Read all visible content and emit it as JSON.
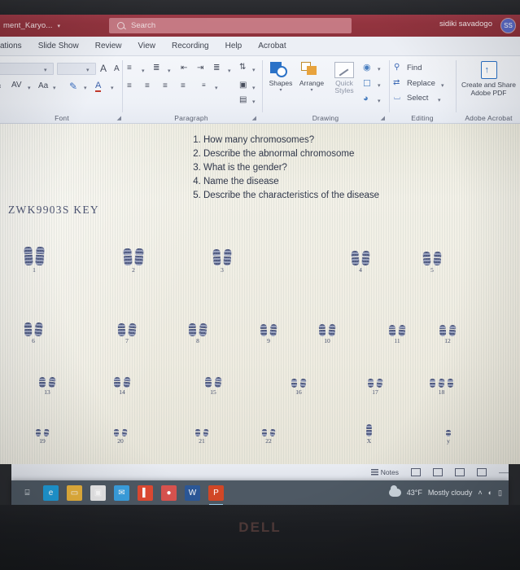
{
  "window": {
    "document_name": "ment_Karyo...",
    "caret": "▾",
    "account_name": "sidiki savadogo",
    "account_initials": "SS",
    "title_bar_color": "#93343f"
  },
  "search": {
    "placeholder": "Search",
    "icon": "search-icon"
  },
  "ribbon": {
    "tabs": [
      "ations",
      "Slide Show",
      "Review",
      "View",
      "Recording",
      "Help",
      "Acrobat"
    ],
    "groups": [
      {
        "name": "Font",
        "label": "Font"
      },
      {
        "name": "Paragraph",
        "label": "Paragraph"
      },
      {
        "name": "Drawing",
        "label": "Drawing"
      },
      {
        "name": "Editing",
        "label": "Editing"
      },
      {
        "name": "Adobe Acrobat",
        "label": "Adobe Acrobat"
      }
    ],
    "font_group": {
      "grow_font": "A",
      "shrink_font": "A",
      "clear_formatting": "A",
      "character_spacing": "AV",
      "change_case": "Aa",
      "text_highlight": "✎",
      "font_color": "A"
    },
    "drawing_group": {
      "shapes_label": "Shapes",
      "arrange_label": "Arrange",
      "quick_styles_label": "Quick",
      "quick_styles_label2": "Styles",
      "shape_fill": "fill-icon",
      "shape_outline": "outline-icon",
      "shape_effects": "effects-icon"
    },
    "editing_group": {
      "find": "Find",
      "replace": "Replace",
      "select": "Select"
    },
    "acrobat_group": {
      "line1": "Create and Share",
      "line2": "Adobe PDF"
    }
  },
  "slide": {
    "questions": [
      "How many chromosomes?",
      "Describe the abnormal chromosome",
      "What is the gender?",
      "Name the disease",
      "Describe the characteristics of the disease"
    ],
    "key_label": "ZWK9903S KEY",
    "karyotype": {
      "rows": [
        {
          "groups": [
            {
              "number": "1",
              "count": 2
            },
            {
              "number": "2",
              "count": 2
            },
            {
              "number": "3",
              "count": 2
            },
            {
              "number": "4",
              "count": 2
            },
            {
              "number": "5",
              "count": 2
            }
          ]
        },
        {
          "groups": [
            {
              "number": "6",
              "count": 2
            },
            {
              "number": "7",
              "count": 2
            },
            {
              "number": "8",
              "count": 2
            },
            {
              "number": "9",
              "count": 2
            },
            {
              "number": "10",
              "count": 2
            },
            {
              "number": "11",
              "count": 2
            },
            {
              "number": "12",
              "count": 2
            }
          ]
        },
        {
          "groups": [
            {
              "number": "13",
              "count": 2
            },
            {
              "number": "14",
              "count": 2
            },
            {
              "number": "15",
              "count": 2
            },
            {
              "number": "16",
              "count": 2
            },
            {
              "number": "17",
              "count": 2
            },
            {
              "number": "18",
              "count": 3
            }
          ]
        },
        {
          "groups": [
            {
              "number": "19",
              "count": 2
            },
            {
              "number": "20",
              "count": 2
            },
            {
              "number": "21",
              "count": 2
            },
            {
              "number": "22",
              "count": 2
            },
            {
              "number": "X",
              "count": 1
            },
            {
              "number": "y",
              "count": 1
            }
          ]
        }
      ]
    }
  },
  "status_bar": {
    "notes_label": "Notes",
    "view_buttons": [
      "normal-view",
      "slide-sorter-view",
      "reading-view",
      "slide-show-view"
    ]
  },
  "taskbar": {
    "apps": [
      {
        "name": "task-view",
        "glyph": "⌸",
        "color": "#4e5964"
      },
      {
        "name": "edge",
        "glyph": "e",
        "color": "#1f9bd8"
      },
      {
        "name": "file-explorer",
        "glyph": "▭",
        "color": "#e8b23c"
      },
      {
        "name": "microsoft-store",
        "glyph": "▣",
        "color": "#e9e9ea"
      },
      {
        "name": "mail",
        "glyph": "✉",
        "color": "#3aa0e0"
      },
      {
        "name": "office",
        "glyph": "▌",
        "color": "#e04a32"
      },
      {
        "name": "chrome",
        "glyph": "●",
        "color": "#d9534f"
      },
      {
        "name": "word",
        "glyph": "W",
        "color": "#2b5797"
      },
      {
        "name": "powerpoint",
        "glyph": "P",
        "color": "#d24726"
      }
    ],
    "weather_temp": "43°F",
    "weather_desc": "Mostly cloudy",
    "chevron": "˄"
  },
  "monitor": {
    "brand": "DELL"
  }
}
